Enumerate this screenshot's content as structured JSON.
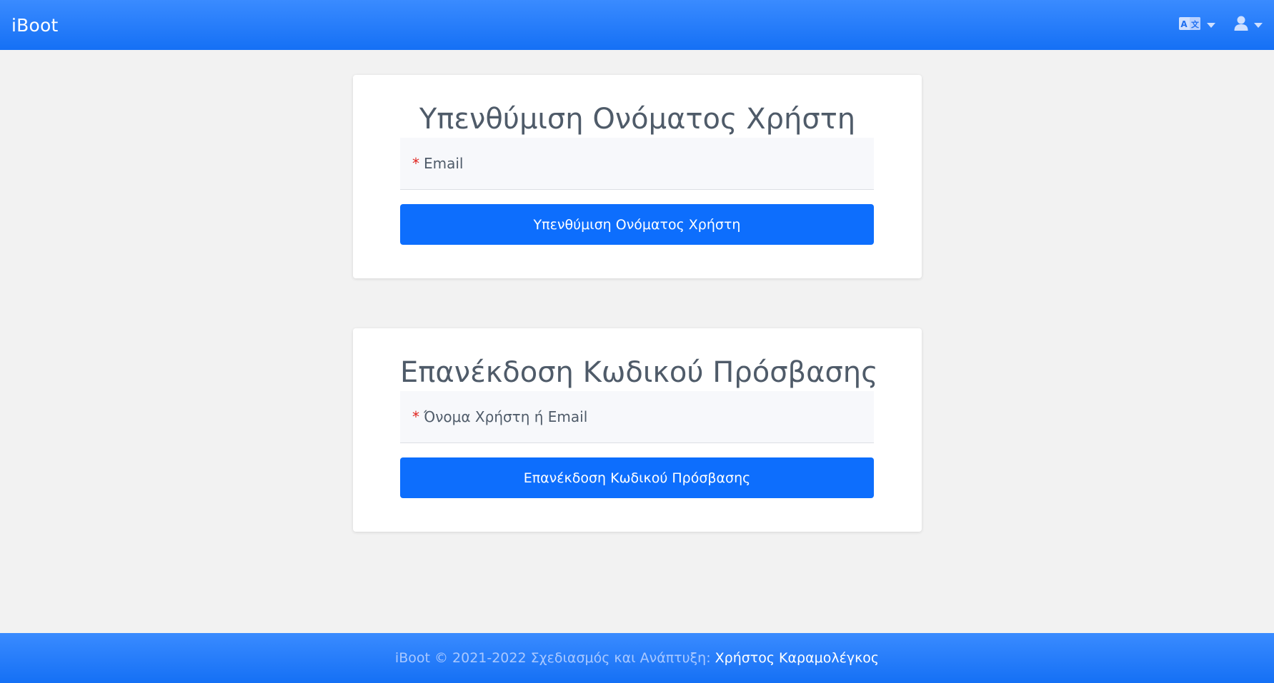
{
  "header": {
    "brand": "iBoot",
    "language_icon": "language-icon",
    "user_icon": "user-icon"
  },
  "username_reminder": {
    "title": "Υπενθύμιση Ονόματος Χρήστη",
    "required_mark": "*",
    "field_label": "Email",
    "button_label": "Υπενθύμιση Ονόματος Χρήστη"
  },
  "password_reset": {
    "title": "Επανέκδοση Κωδικού Πρόσβασης",
    "required_mark": "*",
    "field_label": "Όνομα Χρήστη ή Email",
    "button_label": "Επανέκδοση Κωδικού Πρόσβασης"
  },
  "footer": {
    "text": "iBoot © 2021-2022 Σχεδιασμός και Ανάπτυξη:",
    "author": "Χρήστος Καραμολέγκος"
  },
  "colors": {
    "primary": "#0d6efd",
    "navbar": "#2a7fff",
    "required": "#e0211c"
  }
}
